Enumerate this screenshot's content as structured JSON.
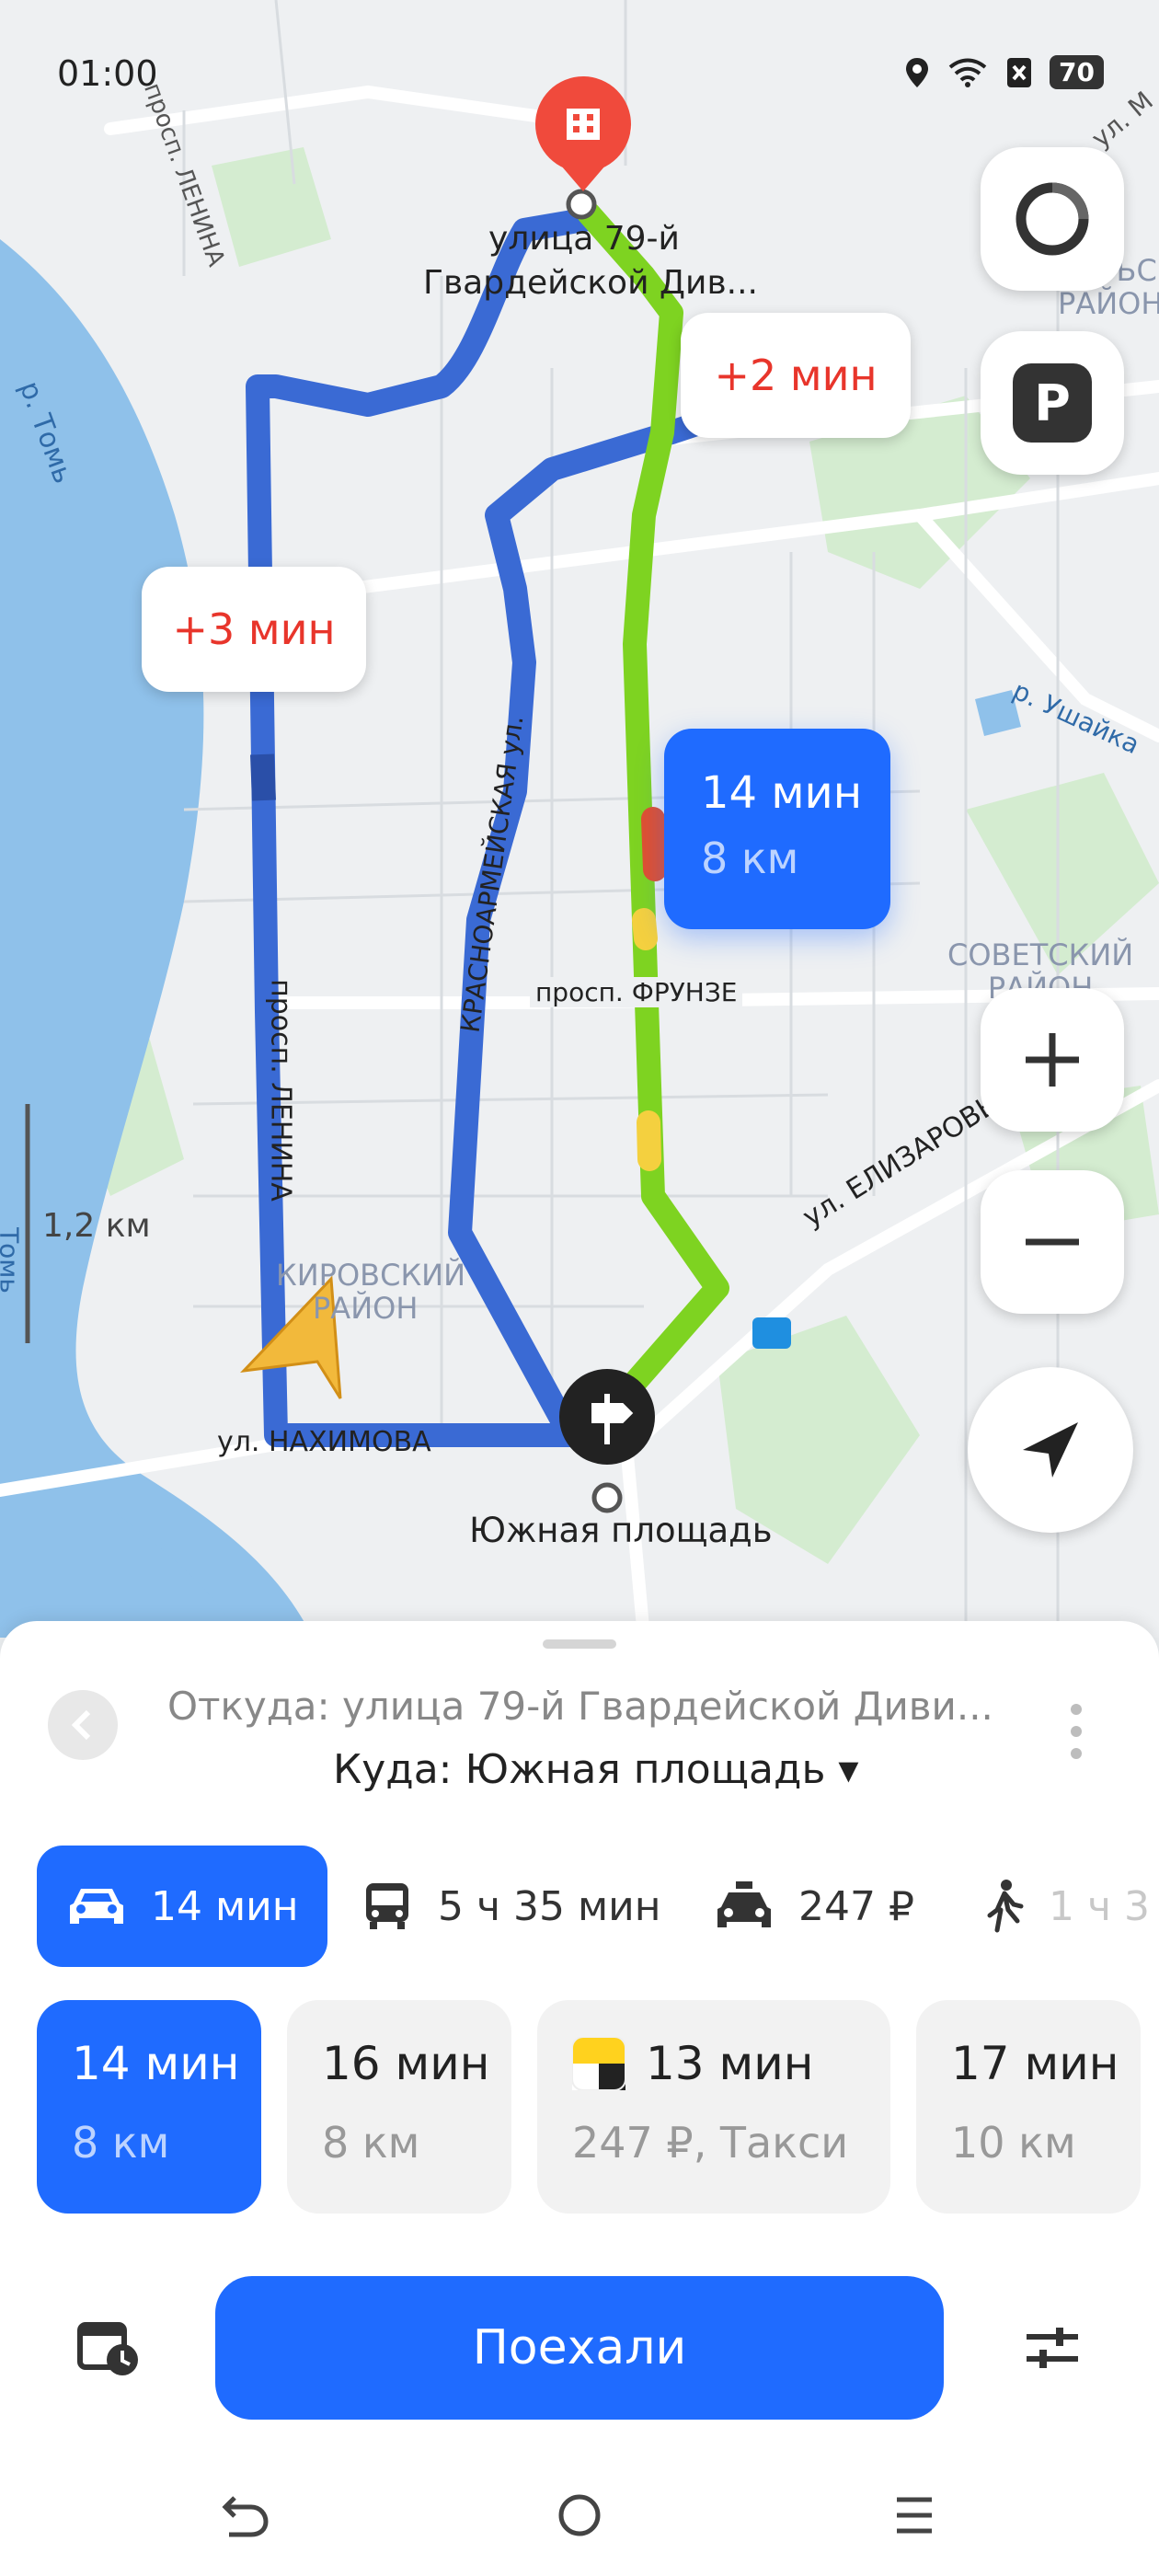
{
  "status": {
    "time": "01:00",
    "battery": "70"
  },
  "map": {
    "destination_label": "улица 79-й\nГвардейской Див...",
    "origin_label": "Южная площадь",
    "bubble_alt1": "+2 мин",
    "bubble_alt2": "+3 мин",
    "bubble_main_time": "14 мин",
    "bubble_main_dist": "8 км",
    "scale": "1,2 км",
    "streets": {
      "lenina_top": "просп. ЛЕНИНА",
      "lenina": "просп. ЛЕНИНА",
      "krasnoarmeyskaya": "КРАСНОАРМЕЙСКАЯ ул.",
      "frunze": "просп. ФРУНЗЕ",
      "nakhimova": "ул. НАХИМОВА",
      "elizarovyh": "ул. ЕЛИЗАРОВЫХ",
      "tom": "р. Томь",
      "tom2": "Томь",
      "ushayka": "р. Ушайка",
      "ul_top": "ул. М"
    },
    "districts": {
      "kirovsky_1": "КИРОВСКИЙ",
      "kirovsky_2": "РАЙОН",
      "sovetsky_1": "СОВЕТСКИЙ",
      "sovetsky_2": "РАЙОН",
      "oktyabrsky_1": "ЯБРЬСК",
      "oktyabrsky_2": "РАЙОН"
    },
    "parking_icon_label": "P"
  },
  "sheet": {
    "from": "Откуда: улица 79-й Гвардейской Диви...",
    "to": "Куда: Южная площадь ▾",
    "modes": [
      {
        "label": "14 мин",
        "icon": "car-icon"
      },
      {
        "label": "5 ч 35 мин",
        "icon": "bus-icon"
      },
      {
        "label": "247 ₽",
        "icon": "taxi-icon"
      },
      {
        "label": "1 ч 3",
        "icon": "walk-icon"
      }
    ],
    "routes": [
      {
        "top": "14 мин",
        "bottom": "8 км"
      },
      {
        "top": "16 мин",
        "bottom": "8 км"
      },
      {
        "top": "13 мин",
        "bottom": "247 ₽, Такси"
      },
      {
        "top": "17 мин",
        "bottom": "10 км"
      }
    ],
    "go_label": "Поехали"
  },
  "colors": {
    "accent": "#1f6bff",
    "route_fast": "#7ed321",
    "route_alt": "#3a6ad4",
    "delay_red": "#e8352b"
  }
}
